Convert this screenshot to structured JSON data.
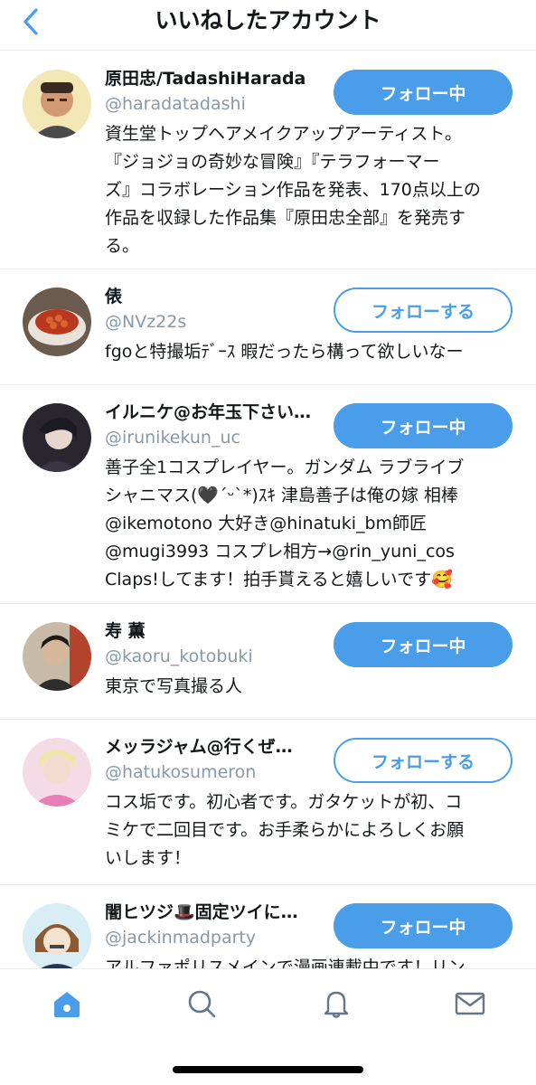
{
  "header": {
    "title": "いいねしたアカウント"
  },
  "accounts": [
    {
      "name": "原田忠/TadashiHarada",
      "handle": "@haradatadashi",
      "button": "フォロー中",
      "bio": "資生堂トップヘアメイクアップアーティスト。\n『ジョジョの奇妙な冒険』『テラフォーマー\nズ』コラボレーション作品を発表、170点以上の\n作品を収録した作品集『原田忠全部』を発売す\nる。"
    },
    {
      "name": "俵",
      "handle": "@NVz22s",
      "button": "フォローする",
      "bio": "fgoと特撮垢ﾃﾞｰｽ 暇だったら構って欲しいなー"
    },
    {
      "name": "イルニケ@お年玉下さい…",
      "handle": "@irunikekun_uc",
      "button": "フォロー中",
      "bio": "善子全1コスプレイヤー。ガンダム ラブライブ\nシャニマス(🖤´ᵕ`*)ｽｷ 津島善子は俺の嫁 相棒\n@ikemotono 大好き@hinatuki_bm師匠\n@mugi3993 コスプレ相方→@rin_yuni_cos\nClaps!してます！拍手貰えると嬉しいです🥰"
    },
    {
      "name": "寿 薫",
      "handle": "@kaoru_kotobuki",
      "button": "フォロー中",
      "bio": "東京で写真撮る人"
    },
    {
      "name": "メッラジャム@行くぜ…",
      "handle": "@hatukosumeron",
      "button": "フォローする",
      "bio": "コス垢です。初心者です。ガタケットが初、コ\nミケで二回目です。お手柔らかによろしくお願\nいします！"
    },
    {
      "name": "闇ヒツジ🎩固定ツイに…",
      "handle": "@jackinmadparty",
      "button": "フォロー中",
      "bio": "アルファポリスメインで漫画連載中です！リン"
    }
  ],
  "tabs": [
    "home-icon",
    "search-icon",
    "bell-icon",
    "mail-icon"
  ],
  "colors": {
    "accent": "#4a9de8",
    "muted": "#8899a6",
    "divider": "#e6ecf0"
  }
}
